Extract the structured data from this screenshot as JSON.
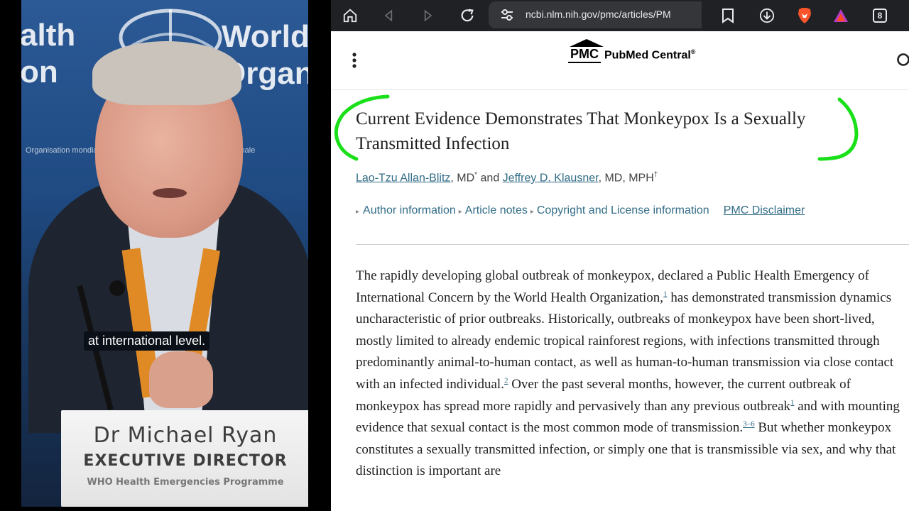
{
  "video": {
    "banner_left_1": "alth",
    "banner_left_2": "on",
    "banner_right_1": "World",
    "banner_right_2": "Organ",
    "banner_small_left": "Organisation mondiale de la S",
    "banner_small_right": "ionale",
    "caption": "at international level.",
    "nameplate": {
      "name": "Dr Michael Ryan",
      "title": "EXECUTIVE DIRECTOR",
      "program": "WHO Health Emergencies Programme"
    }
  },
  "browser": {
    "url": "ncbi.nlm.nih.gov/pmc/articles/PM",
    "tab_count": "8",
    "colors": {
      "toolbar": "#202124",
      "link": "#336d87",
      "annotation": "#19e019"
    }
  },
  "header": {
    "logo_mark": "PMC",
    "logo_name": "PubMed Central",
    "logo_reg": "®"
  },
  "article": {
    "title_line1": "Current Evidence Demonstrates That Monkeypox Is a Sexually",
    "title_line2": "Transmitted Infection",
    "author1": "Lao-Tzu Allan-Blitz",
    "author1_suffix": ", MD",
    "author1_mark": "*",
    "and": " and ",
    "author2": "Jeffrey D. Klausner",
    "author2_suffix": ", MD, MPH",
    "author2_mark": "†",
    "links": {
      "author_info": "Author information",
      "article_notes": "Article notes",
      "copyright": "Copyright and License information",
      "disclaimer": "PMC Disclaimer"
    },
    "body": {
      "s1": "The rapidly developing global outbreak of monkeypox, declared a Public Health Emergency of International Concern by the World Health Organization,",
      "r1": "1",
      "s2": " has demonstrated transmission dynamics uncharacteristic of prior outbreaks. Historically, outbreaks of monkeypox have been short-lived, mostly limited to already endemic tropical rainforest regions, with infections transmitted through predominantly animal-to-human contact, as well as human-to-human transmission via close contact with an infected individual.",
      "r2": "2",
      "s3": " Over the past several months, however, the current outbreak of monkeypox has spread more rapidly and pervasively than any previous outbreak",
      "r3": "1",
      "s4": " and with mounting evidence that sexual contact is the most common mode of transmission.",
      "r4": "3–6",
      "s5": " But whether monkeypox constitutes a sexually transmitted infection, or simply one that is transmissible via sex, and why that distinction is important are"
    }
  }
}
